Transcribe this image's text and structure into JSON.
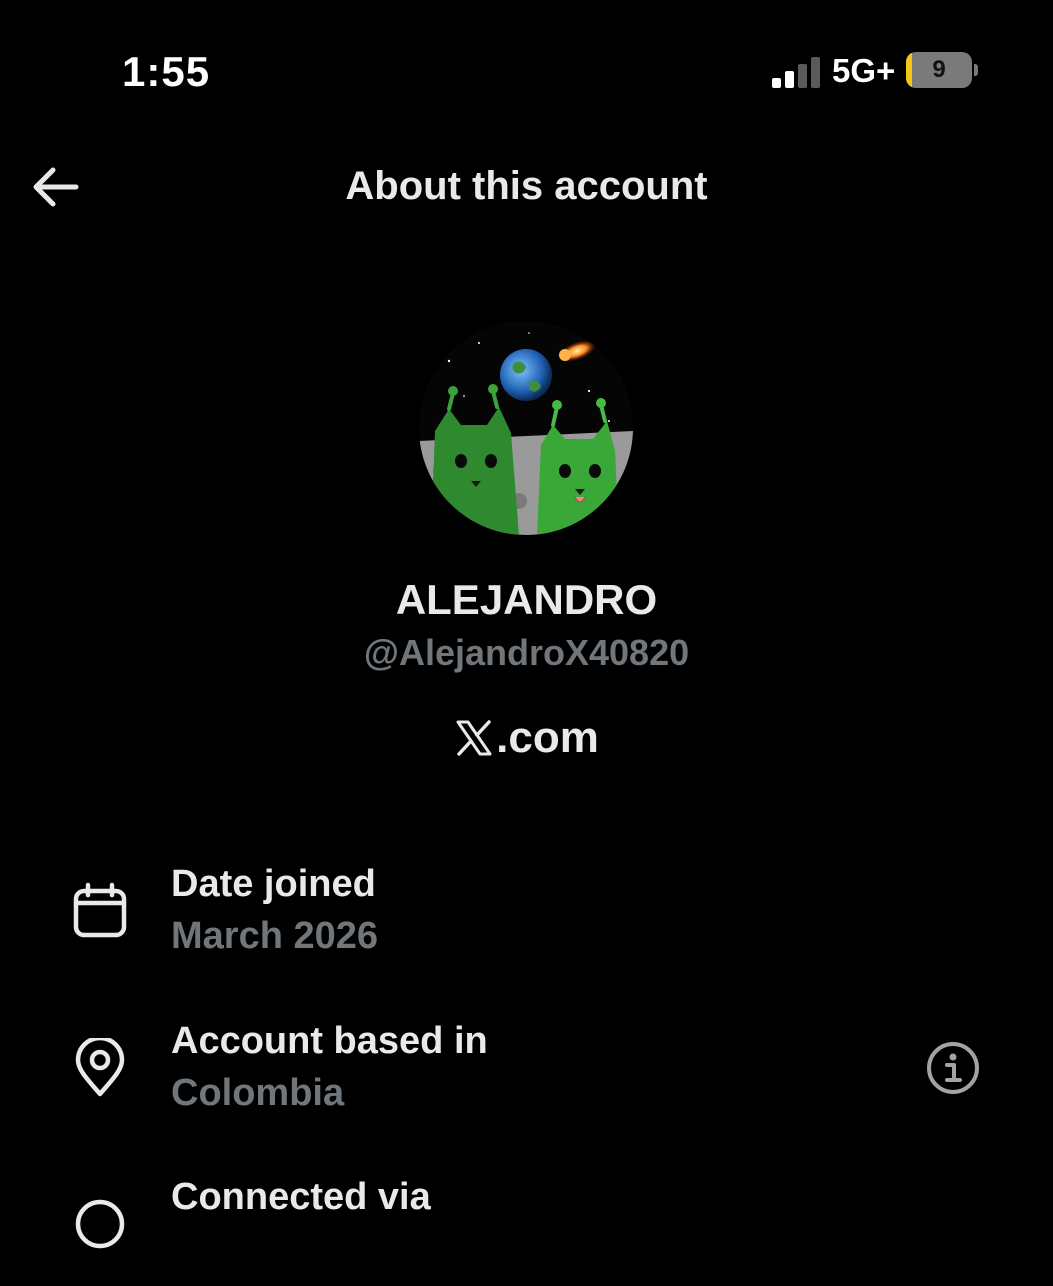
{
  "status_bar": {
    "time": "1:55",
    "network": "5G+",
    "battery_level": "9",
    "battery_fraction": 0.09,
    "signal_bars_active": 2,
    "signal_bars_total": 4,
    "signal_icon": "cellular-signal-icon"
  },
  "header": {
    "back_icon": "arrow-left-icon",
    "title": "About this account"
  },
  "profile": {
    "avatar_icon": "avatar-image",
    "display_name": "ALEJANDRO",
    "handle": "@AlejandroX40820",
    "site_logo_icon": "x-logo-icon",
    "site_domain": ".com"
  },
  "details": [
    {
      "icon": "calendar-icon",
      "label": "Date joined",
      "value": "March 2026"
    },
    {
      "icon": "location-pin-icon",
      "label": "Account based in",
      "value": "Colombia",
      "action_icon": "info-icon"
    },
    {
      "icon": "link-icon",
      "label": "Connected via",
      "value": ""
    }
  ],
  "colors": {
    "background": "#000000",
    "primary_text": "#e7e9ea",
    "secondary_text": "#71767b",
    "battery_accent": "#f5c518"
  }
}
